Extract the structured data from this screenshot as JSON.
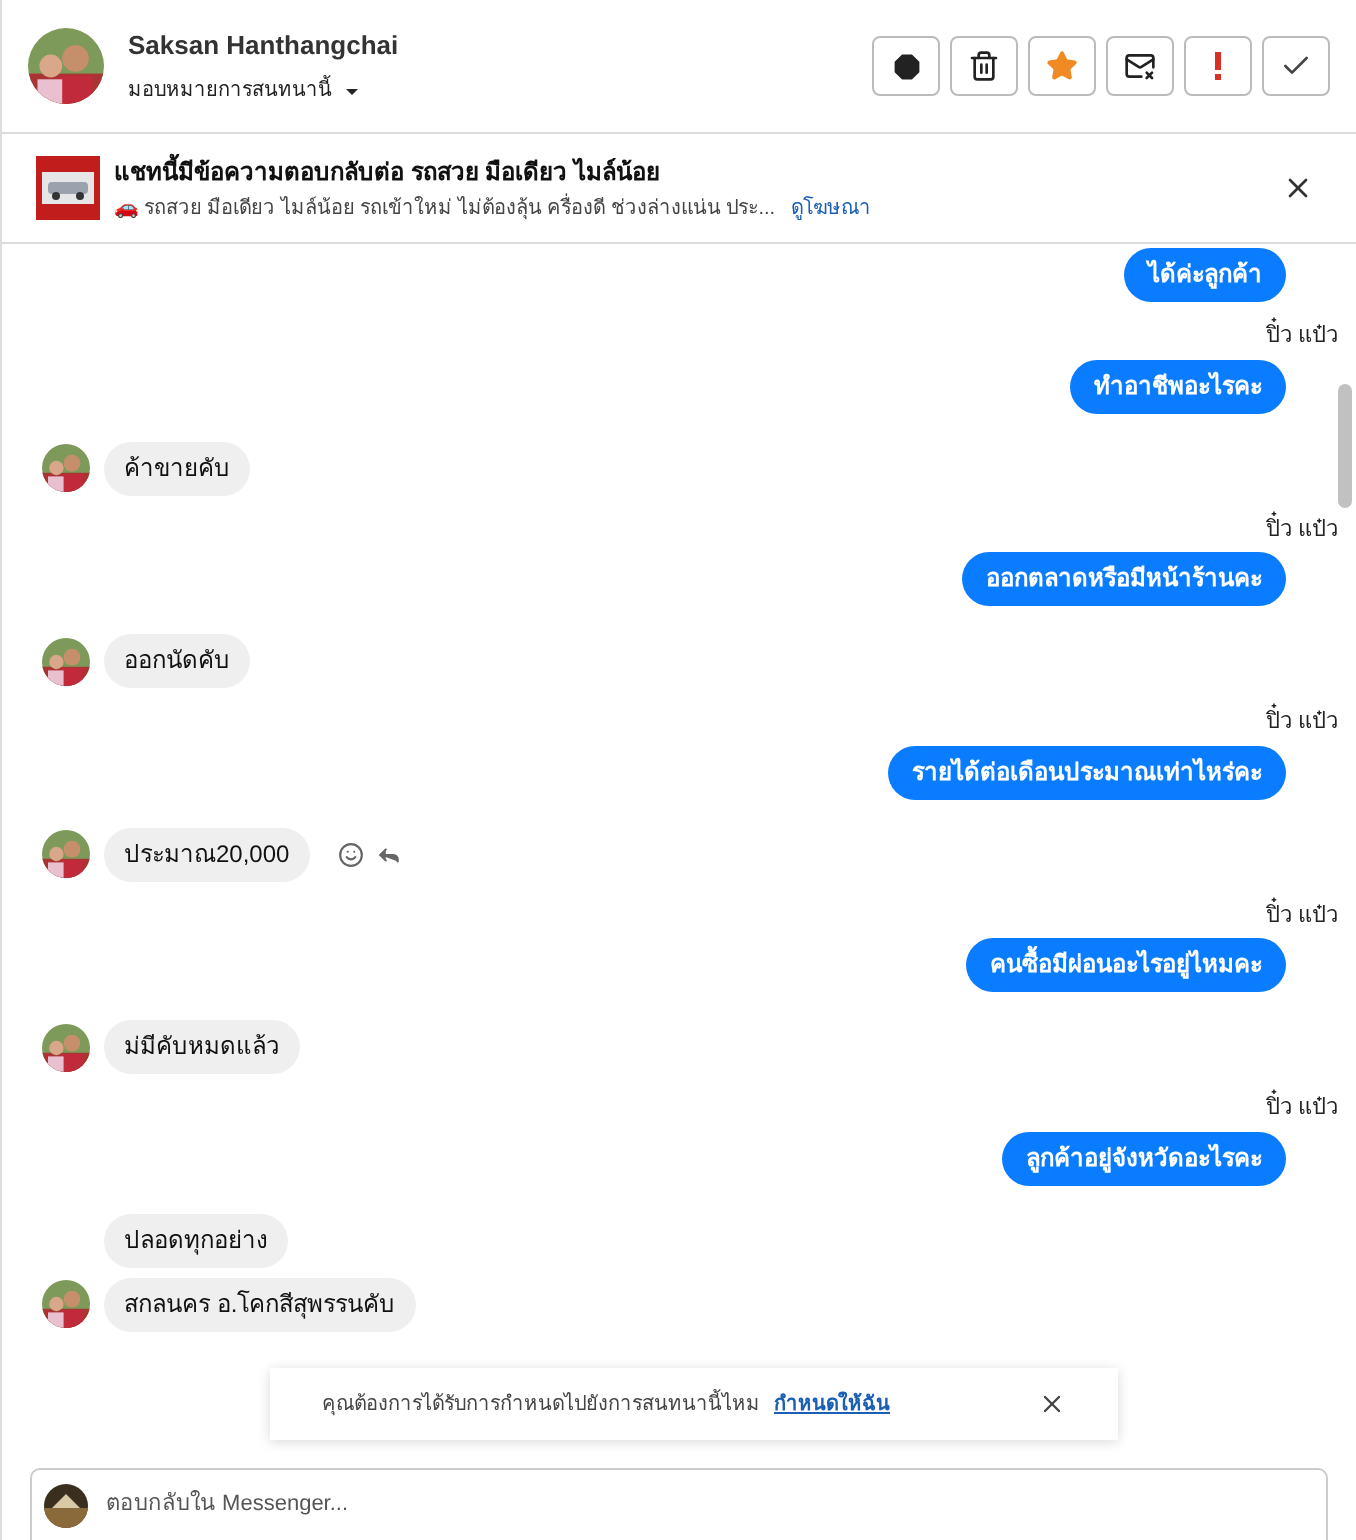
{
  "header": {
    "name": "Saksan Hanthangchai",
    "assign": "มอบหมายการสนทนานี้",
    "actions": [
      {
        "kind": "spam"
      },
      {
        "kind": "delete"
      },
      {
        "kind": "star"
      },
      {
        "kind": "unread"
      },
      {
        "kind": "important"
      },
      {
        "kind": "done"
      }
    ]
  },
  "ad": {
    "title": "แชทนี้มีข้อความตอบกลับต่อ รถสวย มือเดียว ไมล์น้อย",
    "text": "🚗 รถสวย มือเดียว ไมล์น้อย รถเข้าใหม่ ไม่ต้องลุ้น ครื่องดี ช่วงล่างแน่น ประ...",
    "link": "ดูโฆษณา"
  },
  "messages": [
    {
      "kind": "outgoing",
      "text": "ได้ค่ะลูกค้า"
    },
    {
      "kind": "outgoing",
      "sender": "ปิ๋ว แป๋ว",
      "text": "ทำอาชีพอะไรคะ"
    },
    {
      "kind": "incoming",
      "text": "ค้าขายคับ",
      "avatar": true
    },
    {
      "kind": "outgoing",
      "sender": "ปิ๋ว แป๋ว",
      "text": "ออกตลาดหรือมีหน้าร้านคะ"
    },
    {
      "kind": "incoming",
      "text": "ออกนัดคับ",
      "avatar": true
    },
    {
      "kind": "outgoing",
      "sender": "ปิ๋ว แป๋ว",
      "text": "รายได้ต่อเดือนประมาณเท่าไหร่คะ"
    },
    {
      "kind": "incoming",
      "text": "ประมาณ20,000",
      "avatar": true,
      "actions": true
    },
    {
      "kind": "outgoing",
      "sender": "ปิ๋ว แป๋ว",
      "text": "คนซื้อมีผ่อนอะไรอยู่ไหมคะ"
    },
    {
      "kind": "incoming",
      "text": "ม่มีคับหมดแล้ว",
      "avatar": true
    },
    {
      "kind": "outgoing",
      "sender": "ปิ๋ว แป๋ว",
      "text": "ลูกค้าอยู่จังหวัดอะไรคะ"
    },
    {
      "kind": "incoming",
      "text": "ปลอดทุกอย่าง",
      "avatar": false
    },
    {
      "kind": "incoming",
      "text": "สกลนคร อ.โคกสีสุพรรนคับ",
      "avatar": true
    }
  ],
  "notice": {
    "text": "คุณต้องการได้รับการกำหนดไปยังการสนทนานี้ไหม",
    "link": "กำหนดให้ฉัน"
  },
  "composer": {
    "placeholder": "ตอบกลับใน Messenger..."
  }
}
